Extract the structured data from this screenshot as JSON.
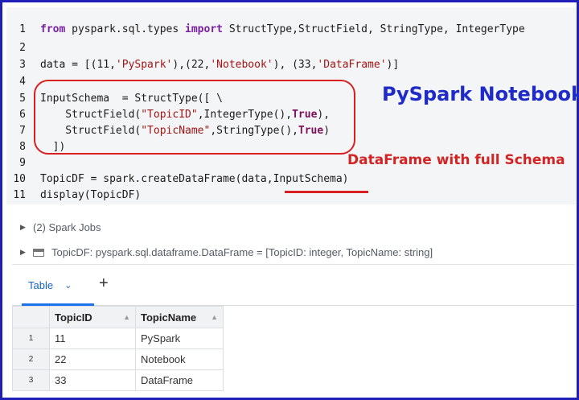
{
  "code": {
    "line_numbers": [
      "1",
      "2",
      "3",
      "4",
      "5",
      "6",
      "7",
      "8",
      "9",
      "10",
      "11"
    ],
    "lines": [
      [
        {
          "t": "from",
          "c": "kw"
        },
        {
          "t": " pyspark.sql.types ",
          "c": ""
        },
        {
          "t": "import",
          "c": "kw"
        },
        {
          "t": " StructType,StructField, StringType, IntegerType",
          "c": ""
        }
      ],
      [],
      [
        {
          "t": "data = [(11,",
          "c": ""
        },
        {
          "t": "'PySpark'",
          "c": "str"
        },
        {
          "t": "),(22,",
          "c": ""
        },
        {
          "t": "'Notebook'",
          "c": "str"
        },
        {
          "t": "), (33,",
          "c": ""
        },
        {
          "t": "'DataFrame'",
          "c": "str"
        },
        {
          "t": ")]",
          "c": ""
        }
      ],
      [],
      [
        {
          "t": "InputSchema  = StructType([ \\",
          "c": ""
        }
      ],
      [
        {
          "t": "    StructField(",
          "c": ""
        },
        {
          "t": "\"TopicID\"",
          "c": "str"
        },
        {
          "t": ",IntegerType(),",
          "c": ""
        },
        {
          "t": "True",
          "c": "kw2"
        },
        {
          "t": "),",
          "c": ""
        }
      ],
      [
        {
          "t": "    StructField(",
          "c": ""
        },
        {
          "t": "\"TopicName\"",
          "c": "str"
        },
        {
          "t": ",StringType(),",
          "c": ""
        },
        {
          "t": "True",
          "c": "kw2"
        },
        {
          "t": ")",
          "c": ""
        }
      ],
      [
        {
          "t": "  ])",
          "c": ""
        }
      ],
      [],
      [
        {
          "t": "TopicDF = spark.createDataFrame(data,InputSchema)",
          "c": ""
        }
      ],
      [
        {
          "t": "display(TopicDF)",
          "c": ""
        }
      ]
    ]
  },
  "annotations": {
    "title": "PySpark Notebook",
    "subtitle": "DataFrame with full Schema"
  },
  "output": {
    "spark_jobs": "(2) Spark Jobs",
    "dataframe_info": "TopicDF:  pyspark.sql.dataframe.DataFrame = [TopicID: integer, TopicName: string]"
  },
  "tabs": {
    "table_label": "Table",
    "chevron": "⌄",
    "add": "+"
  },
  "table": {
    "columns": [
      "TopicID",
      "TopicName"
    ],
    "rows": [
      {
        "index": "1",
        "values": [
          "11",
          "PySpark"
        ]
      },
      {
        "index": "2",
        "values": [
          "22",
          "Notebook"
        ]
      },
      {
        "index": "3",
        "values": [
          "33",
          "DataFrame"
        ]
      }
    ]
  },
  "colors": {
    "frame_border": "#1f1fb8",
    "annotation_red": "#d42323",
    "annotation_blue": "#1e2bc8",
    "tab_accent": "#1a73e8"
  },
  "icons": [
    "caret-right-icon",
    "dataframe-icon",
    "chevron-down-icon",
    "sort-icon"
  ]
}
